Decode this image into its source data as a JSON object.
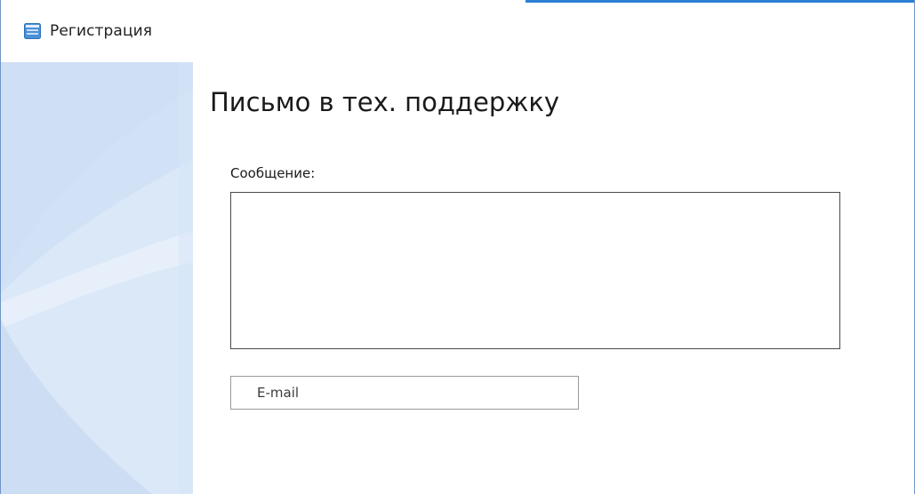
{
  "window": {
    "title": "Регистрация",
    "icon": "app-window-icon"
  },
  "main": {
    "heading": "Письмо в тех. поддержку",
    "message_label": "Сообщение:",
    "message_value": "",
    "email_placeholder": "E-mail",
    "email_value": ""
  },
  "colors": {
    "side_panel": "#d2e2f6",
    "top_accent": "#2d7fd3",
    "window_border": "#6f95c7"
  }
}
